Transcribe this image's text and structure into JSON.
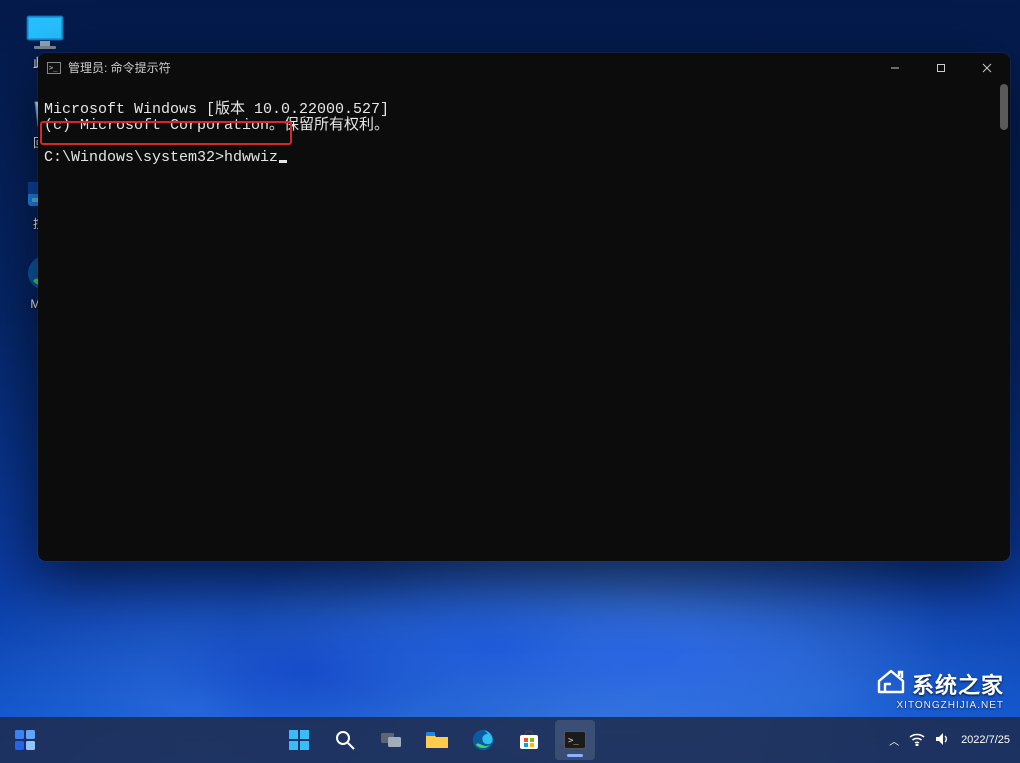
{
  "desktop": {
    "icons": [
      {
        "name": "this-pc-icon",
        "label": "此电"
      },
      {
        "name": "recycle-bin-icon",
        "label": "回收"
      },
      {
        "name": "control-panel-icon",
        "label": "控制"
      },
      {
        "name": "edge-icon",
        "label": "Micro\nEd"
      }
    ]
  },
  "terminal": {
    "title": "管理员: 命令提示符",
    "line1": "Microsoft Windows [版本 10.0.22000.527]",
    "line2": "(c) Microsoft Corporation。保留所有权利。",
    "prompt": "C:\\Windows\\system32>",
    "command": "hdwwiz"
  },
  "taskbar": {
    "tray": {
      "chevron": "▲"
    },
    "clock": {
      "time": "",
      "date": "2022/7/25"
    }
  },
  "watermark": {
    "brand": "系统之家",
    "url": "XITONGZHIJIA.NET"
  }
}
